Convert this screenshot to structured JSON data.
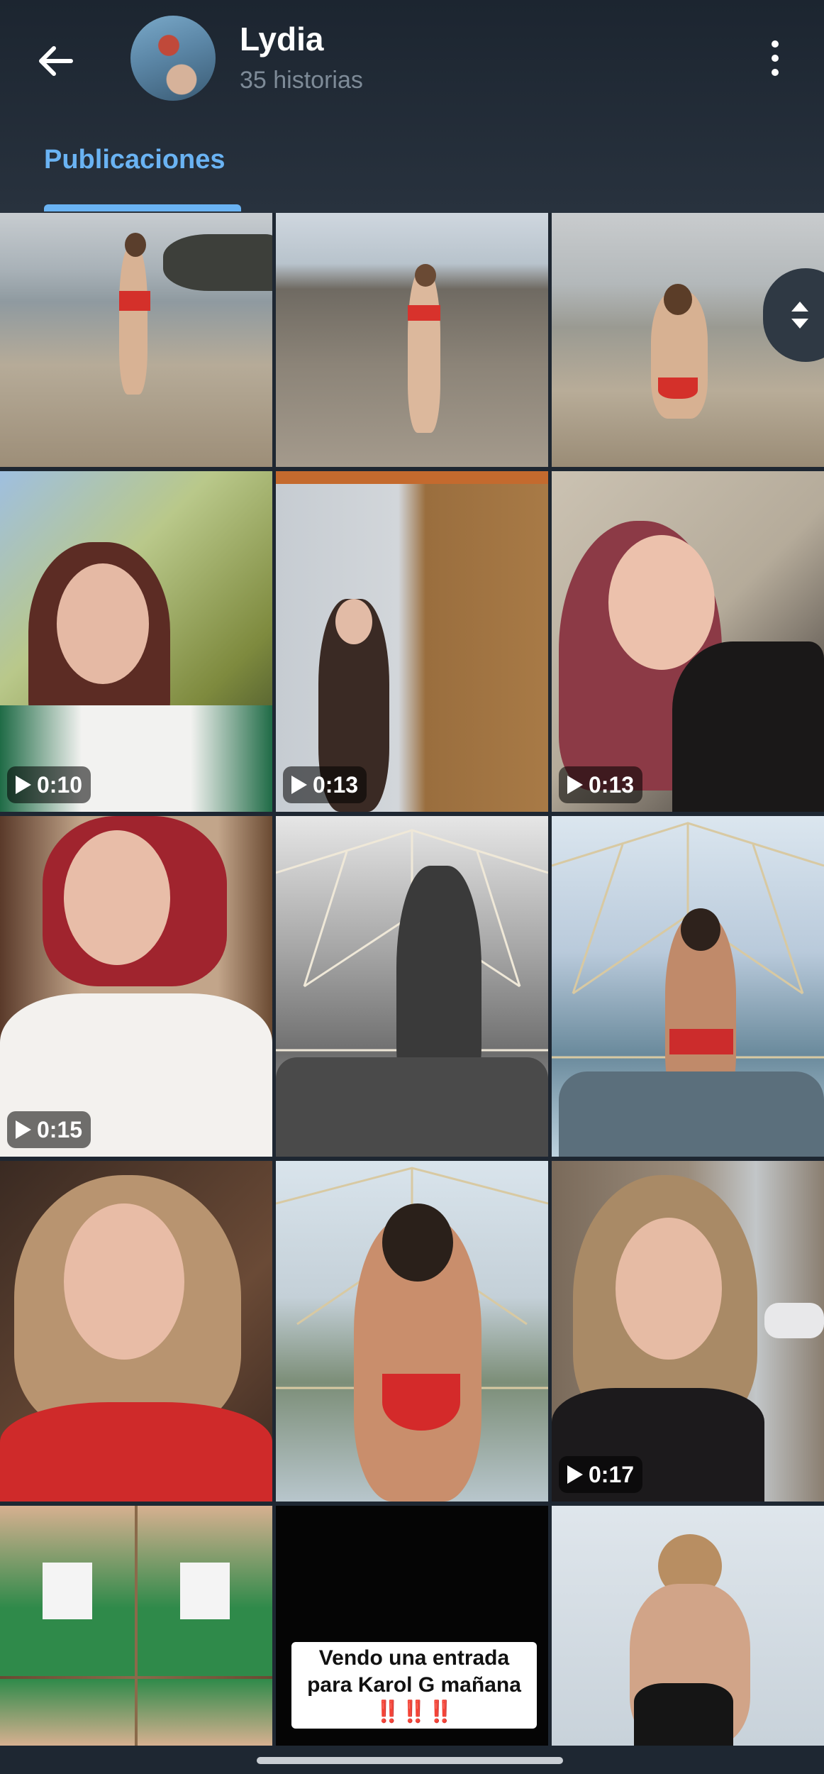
{
  "header": {
    "title": "Lydia",
    "subtitle": "35 historias",
    "tab_label": "Publicaciones"
  },
  "icons": {
    "back": "arrow-left-icon",
    "menu": "more-vertical-icon",
    "scroll": "scroll-handle-icon",
    "play": "play-icon"
  },
  "grid": {
    "durations": {
      "r2c1": "0:10",
      "r2c2": "0:13",
      "r2c3": "0:13",
      "r3c1": "0:15",
      "r4c3": "0:17"
    },
    "story_text": "Vendo una entrada para Karol G mañana ‼️‼️‼️"
  },
  "colors": {
    "background": "#1e2732",
    "accent": "#6ab3f3",
    "subtitle": "#7e8b98"
  }
}
